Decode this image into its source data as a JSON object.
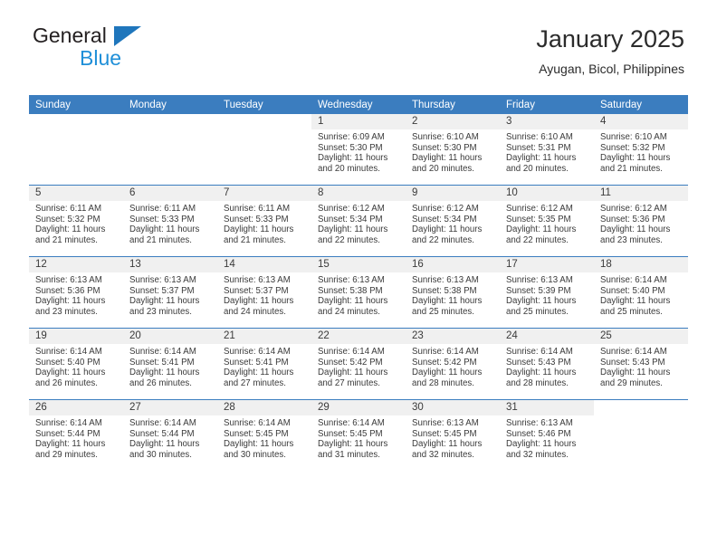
{
  "brand": {
    "name_top": "General",
    "name_bottom": "Blue",
    "triangle_color": "#1f76bc",
    "blue_text_color": "#1f8fd8"
  },
  "header": {
    "title": "January 2025",
    "subtitle": "Ayugan, Bicol, Philippines"
  },
  "theme": {
    "header_band": "#3b7dbf",
    "daynum_band": "#f0f0f0",
    "text": "#3a3a3a"
  },
  "weekdays": [
    "Sunday",
    "Monday",
    "Tuesday",
    "Wednesday",
    "Thursday",
    "Friday",
    "Saturday"
  ],
  "labels": {
    "sunrise_prefix": "Sunrise:",
    "sunset_prefix": "Sunset:",
    "daylight_prefix": "Daylight:"
  },
  "weeks": [
    [
      {
        "day": "",
        "blank": true
      },
      {
        "day": "",
        "blank": true
      },
      {
        "day": "",
        "blank": true
      },
      {
        "day": "1",
        "sunrise": "Sunrise: 6:09 AM",
        "sunset": "Sunset: 5:30 PM",
        "daylight": "Daylight: 11 hours and 20 minutes."
      },
      {
        "day": "2",
        "sunrise": "Sunrise: 6:10 AM",
        "sunset": "Sunset: 5:30 PM",
        "daylight": "Daylight: 11 hours and 20 minutes."
      },
      {
        "day": "3",
        "sunrise": "Sunrise: 6:10 AM",
        "sunset": "Sunset: 5:31 PM",
        "daylight": "Daylight: 11 hours and 20 minutes."
      },
      {
        "day": "4",
        "sunrise": "Sunrise: 6:10 AM",
        "sunset": "Sunset: 5:32 PM",
        "daylight": "Daylight: 11 hours and 21 minutes."
      }
    ],
    [
      {
        "day": "5",
        "sunrise": "Sunrise: 6:11 AM",
        "sunset": "Sunset: 5:32 PM",
        "daylight": "Daylight: 11 hours and 21 minutes."
      },
      {
        "day": "6",
        "sunrise": "Sunrise: 6:11 AM",
        "sunset": "Sunset: 5:33 PM",
        "daylight": "Daylight: 11 hours and 21 minutes."
      },
      {
        "day": "7",
        "sunrise": "Sunrise: 6:11 AM",
        "sunset": "Sunset: 5:33 PM",
        "daylight": "Daylight: 11 hours and 21 minutes."
      },
      {
        "day": "8",
        "sunrise": "Sunrise: 6:12 AM",
        "sunset": "Sunset: 5:34 PM",
        "daylight": "Daylight: 11 hours and 22 minutes."
      },
      {
        "day": "9",
        "sunrise": "Sunrise: 6:12 AM",
        "sunset": "Sunset: 5:34 PM",
        "daylight": "Daylight: 11 hours and 22 minutes."
      },
      {
        "day": "10",
        "sunrise": "Sunrise: 6:12 AM",
        "sunset": "Sunset: 5:35 PM",
        "daylight": "Daylight: 11 hours and 22 minutes."
      },
      {
        "day": "11",
        "sunrise": "Sunrise: 6:12 AM",
        "sunset": "Sunset: 5:36 PM",
        "daylight": "Daylight: 11 hours and 23 minutes."
      }
    ],
    [
      {
        "day": "12",
        "sunrise": "Sunrise: 6:13 AM",
        "sunset": "Sunset: 5:36 PM",
        "daylight": "Daylight: 11 hours and 23 minutes."
      },
      {
        "day": "13",
        "sunrise": "Sunrise: 6:13 AM",
        "sunset": "Sunset: 5:37 PM",
        "daylight": "Daylight: 11 hours and 23 minutes."
      },
      {
        "day": "14",
        "sunrise": "Sunrise: 6:13 AM",
        "sunset": "Sunset: 5:37 PM",
        "daylight": "Daylight: 11 hours and 24 minutes."
      },
      {
        "day": "15",
        "sunrise": "Sunrise: 6:13 AM",
        "sunset": "Sunset: 5:38 PM",
        "daylight": "Daylight: 11 hours and 24 minutes."
      },
      {
        "day": "16",
        "sunrise": "Sunrise: 6:13 AM",
        "sunset": "Sunset: 5:38 PM",
        "daylight": "Daylight: 11 hours and 25 minutes."
      },
      {
        "day": "17",
        "sunrise": "Sunrise: 6:13 AM",
        "sunset": "Sunset: 5:39 PM",
        "daylight": "Daylight: 11 hours and 25 minutes."
      },
      {
        "day": "18",
        "sunrise": "Sunrise: 6:14 AM",
        "sunset": "Sunset: 5:40 PM",
        "daylight": "Daylight: 11 hours and 25 minutes."
      }
    ],
    [
      {
        "day": "19",
        "sunrise": "Sunrise: 6:14 AM",
        "sunset": "Sunset: 5:40 PM",
        "daylight": "Daylight: 11 hours and 26 minutes."
      },
      {
        "day": "20",
        "sunrise": "Sunrise: 6:14 AM",
        "sunset": "Sunset: 5:41 PM",
        "daylight": "Daylight: 11 hours and 26 minutes."
      },
      {
        "day": "21",
        "sunrise": "Sunrise: 6:14 AM",
        "sunset": "Sunset: 5:41 PM",
        "daylight": "Daylight: 11 hours and 27 minutes."
      },
      {
        "day": "22",
        "sunrise": "Sunrise: 6:14 AM",
        "sunset": "Sunset: 5:42 PM",
        "daylight": "Daylight: 11 hours and 27 minutes."
      },
      {
        "day": "23",
        "sunrise": "Sunrise: 6:14 AM",
        "sunset": "Sunset: 5:42 PM",
        "daylight": "Daylight: 11 hours and 28 minutes."
      },
      {
        "day": "24",
        "sunrise": "Sunrise: 6:14 AM",
        "sunset": "Sunset: 5:43 PM",
        "daylight": "Daylight: 11 hours and 28 minutes."
      },
      {
        "day": "25",
        "sunrise": "Sunrise: 6:14 AM",
        "sunset": "Sunset: 5:43 PM",
        "daylight": "Daylight: 11 hours and 29 minutes."
      }
    ],
    [
      {
        "day": "26",
        "sunrise": "Sunrise: 6:14 AM",
        "sunset": "Sunset: 5:44 PM",
        "daylight": "Daylight: 11 hours and 29 minutes."
      },
      {
        "day": "27",
        "sunrise": "Sunrise: 6:14 AM",
        "sunset": "Sunset: 5:44 PM",
        "daylight": "Daylight: 11 hours and 30 minutes."
      },
      {
        "day": "28",
        "sunrise": "Sunrise: 6:14 AM",
        "sunset": "Sunset: 5:45 PM",
        "daylight": "Daylight: 11 hours and 30 minutes."
      },
      {
        "day": "29",
        "sunrise": "Sunrise: 6:14 AM",
        "sunset": "Sunset: 5:45 PM",
        "daylight": "Daylight: 11 hours and 31 minutes."
      },
      {
        "day": "30",
        "sunrise": "Sunrise: 6:13 AM",
        "sunset": "Sunset: 5:45 PM",
        "daylight": "Daylight: 11 hours and 32 minutes."
      },
      {
        "day": "31",
        "sunrise": "Sunrise: 6:13 AM",
        "sunset": "Sunset: 5:46 PM",
        "daylight": "Daylight: 11 hours and 32 minutes."
      },
      {
        "day": "",
        "blank": true
      }
    ]
  ]
}
